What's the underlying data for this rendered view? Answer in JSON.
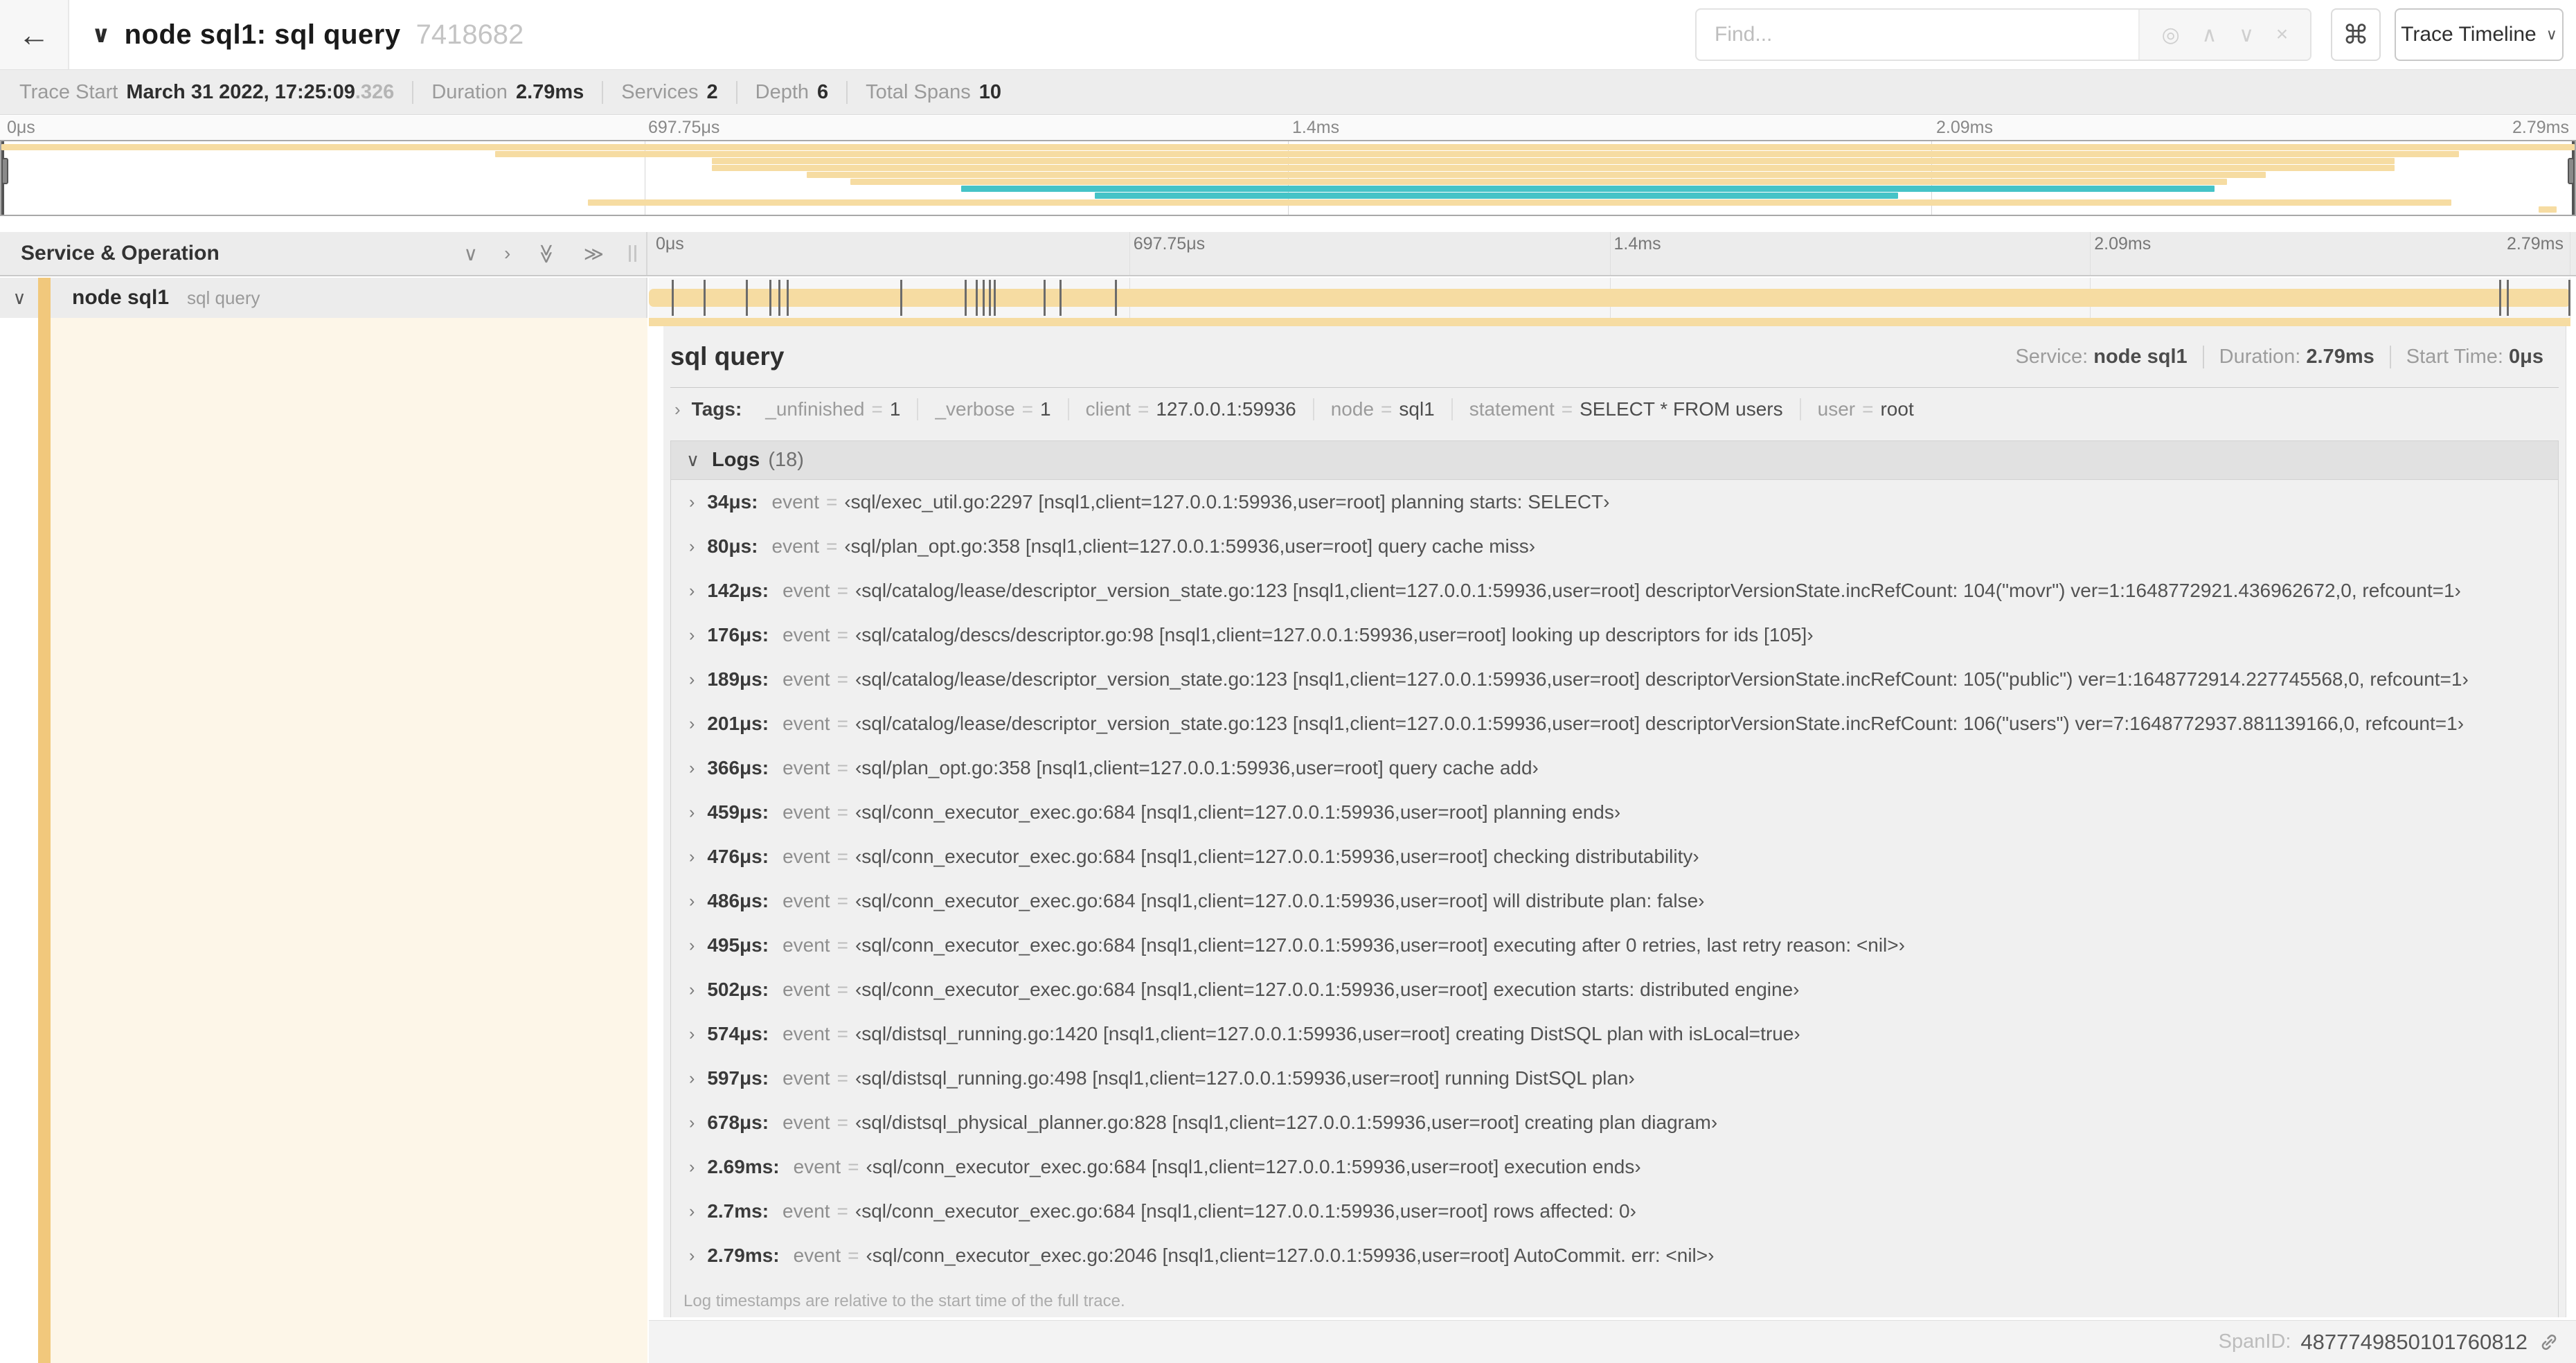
{
  "icons": {
    "back": "←",
    "chevron_down": "∨",
    "chevron_right": "›",
    "double_right": "≫",
    "locate": "◎",
    "up": "∧",
    "down": "∨",
    "close": "×",
    "command": "⌘",
    "equals": "="
  },
  "colors": {
    "orange": "#f6dca2",
    "orange_accent": "#f1c87c",
    "teal": "#45c3c7",
    "cream": "#fdf6e8"
  },
  "header": {
    "title": "node sql1: sql query",
    "trace_id": "7418682",
    "find_placeholder": "Find...",
    "view_selector_label": "Trace Timeline"
  },
  "summary": {
    "items": [
      {
        "label": "Trace Start",
        "value": "March 31 2022, 17:25:09",
        "suffix": ".326"
      },
      {
        "label": "Duration",
        "value": "2.79ms",
        "suffix": ""
      },
      {
        "label": "Services",
        "value": "2",
        "suffix": ""
      },
      {
        "label": "Depth",
        "value": "6",
        "suffix": ""
      },
      {
        "label": "Total Spans",
        "value": "10",
        "suffix": ""
      }
    ]
  },
  "ruler": {
    "ticks": [
      "0μs",
      "697.75μs",
      "1.4ms",
      "2.09ms",
      "2.79ms"
    ]
  },
  "minimap": {
    "spans": [
      {
        "start": 0,
        "end": 100,
        "color": "orange"
      },
      {
        "start": 19.2,
        "end": 95.5,
        "color": "orange"
      },
      {
        "start": 27.6,
        "end": 93,
        "color": "orange"
      },
      {
        "start": 27.6,
        "end": 93,
        "color": "orange"
      },
      {
        "start": 31.3,
        "end": 88,
        "color": "orange"
      },
      {
        "start": 33,
        "end": 86.5,
        "color": "orange"
      },
      {
        "start": 37.3,
        "end": 86,
        "color": "teal"
      },
      {
        "start": 42.5,
        "end": 73.7,
        "color": "teal"
      },
      {
        "start": 22.8,
        "end": 95.2,
        "color": "orange"
      },
      {
        "start": 98.6,
        "end": 99.3,
        "color": "orange"
      }
    ]
  },
  "timeline_header": {
    "left_title": "Service & Operation"
  },
  "span_row": {
    "service": "node sql1",
    "operation": "sql query",
    "total_us": 2790,
    "tick_times_us": [
      34,
      80,
      142,
      176,
      189,
      201,
      366,
      459,
      476,
      486,
      495,
      502,
      574,
      597,
      678,
      2687,
      2699,
      2788
    ]
  },
  "detail": {
    "title": "sql query",
    "service_label": "Service:",
    "service": "node sql1",
    "duration_label": "Duration:",
    "duration": "2.79ms",
    "start_label": "Start Time:",
    "start": "0μs",
    "tags_label": "Tags:",
    "tags": [
      {
        "key": "_unfinished",
        "value": "1"
      },
      {
        "key": "_verbose",
        "value": "1"
      },
      {
        "key": "client",
        "value": "127.0.0.1:59936"
      },
      {
        "key": "node",
        "value": "sql1"
      },
      {
        "key": "statement",
        "value": "SELECT * FROM users"
      },
      {
        "key": "user",
        "value": "root"
      }
    ],
    "logs_label": "Logs",
    "logs_count": "(18)",
    "log_field": "event",
    "logs": [
      {
        "time": "34μs:",
        "value": "‹sql/exec_util.go:2297 [nsql1,client=127.0.0.1:59936,user=root] planning starts: SELECT›"
      },
      {
        "time": "80μs:",
        "value": "‹sql/plan_opt.go:358 [nsql1,client=127.0.0.1:59936,user=root] query cache miss›"
      },
      {
        "time": "142μs:",
        "value": "‹sql/catalog/lease/descriptor_version_state.go:123 [nsql1,client=127.0.0.1:59936,user=root] descriptorVersionState.incRefCount: 104(\"movr\") ver=1:1648772921.436962672,0, refcount=1›"
      },
      {
        "time": "176μs:",
        "value": "‹sql/catalog/descs/descriptor.go:98 [nsql1,client=127.0.0.1:59936,user=root] looking up descriptors for ids [105]›"
      },
      {
        "time": "189μs:",
        "value": "‹sql/catalog/lease/descriptor_version_state.go:123 [nsql1,client=127.0.0.1:59936,user=root] descriptorVersionState.incRefCount: 105(\"public\") ver=1:1648772914.227745568,0, refcount=1›"
      },
      {
        "time": "201μs:",
        "value": "‹sql/catalog/lease/descriptor_version_state.go:123 [nsql1,client=127.0.0.1:59936,user=root] descriptorVersionState.incRefCount: 106(\"users\") ver=7:1648772937.881139166,0, refcount=1›"
      },
      {
        "time": "366μs:",
        "value": "‹sql/plan_opt.go:358 [nsql1,client=127.0.0.1:59936,user=root] query cache add›"
      },
      {
        "time": "459μs:",
        "value": "‹sql/conn_executor_exec.go:684 [nsql1,client=127.0.0.1:59936,user=root] planning ends›"
      },
      {
        "time": "476μs:",
        "value": "‹sql/conn_executor_exec.go:684 [nsql1,client=127.0.0.1:59936,user=root] checking distributability›"
      },
      {
        "time": "486μs:",
        "value": "‹sql/conn_executor_exec.go:684 [nsql1,client=127.0.0.1:59936,user=root] will distribute plan: false›"
      },
      {
        "time": "495μs:",
        "value": "‹sql/conn_executor_exec.go:684 [nsql1,client=127.0.0.1:59936,user=root] executing after 0 retries, last retry reason: <nil>›"
      },
      {
        "time": "502μs:",
        "value": "‹sql/conn_executor_exec.go:684 [nsql1,client=127.0.0.1:59936,user=root] execution starts: distributed engine›"
      },
      {
        "time": "574μs:",
        "value": "‹sql/distsql_running.go:1420 [nsql1,client=127.0.0.1:59936,user=root] creating DistSQL plan with isLocal=true›"
      },
      {
        "time": "597μs:",
        "value": "‹sql/distsql_running.go:498 [nsql1,client=127.0.0.1:59936,user=root] running DistSQL plan›"
      },
      {
        "time": "678μs:",
        "value": "‹sql/distsql_physical_planner.go:828 [nsql1,client=127.0.0.1:59936,user=root] creating plan diagram›"
      },
      {
        "time": "2.69ms:",
        "value": "‹sql/conn_executor_exec.go:684 [nsql1,client=127.0.0.1:59936,user=root] execution ends›"
      },
      {
        "time": "2.7ms:",
        "value": "‹sql/conn_executor_exec.go:684 [nsql1,client=127.0.0.1:59936,user=root] rows affected: 0›"
      },
      {
        "time": "2.79ms:",
        "value": "‹sql/conn_executor_exec.go:2046 [nsql1,client=127.0.0.1:59936,user=root] AutoCommit. err: <nil>›"
      }
    ],
    "footer": "Log timestamps are relative to the start time of the full trace.",
    "spanid_label": "SpanID:",
    "spanid": "4877749850101760812"
  }
}
